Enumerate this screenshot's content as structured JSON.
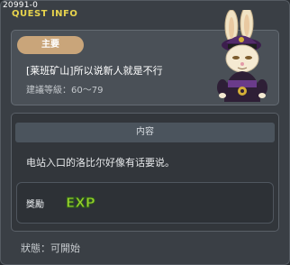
{
  "window": {
    "quest_id": "20991-0",
    "title": "QUEST INFO"
  },
  "quest": {
    "badge": "主要",
    "name": "[莱班矿山]所以说新人就是不行",
    "level": "建議等級：60～79",
    "content_header": "内容",
    "description": "电站入口的洛比尔好像有话要说。",
    "reward_label": "獎勵",
    "reward_icon": "exp-icon",
    "status": "狀態：可開始"
  },
  "colors": {
    "title": "#e8d44d",
    "badge_bg": "#c9a57a",
    "exp_fill": "#9bd12c"
  }
}
